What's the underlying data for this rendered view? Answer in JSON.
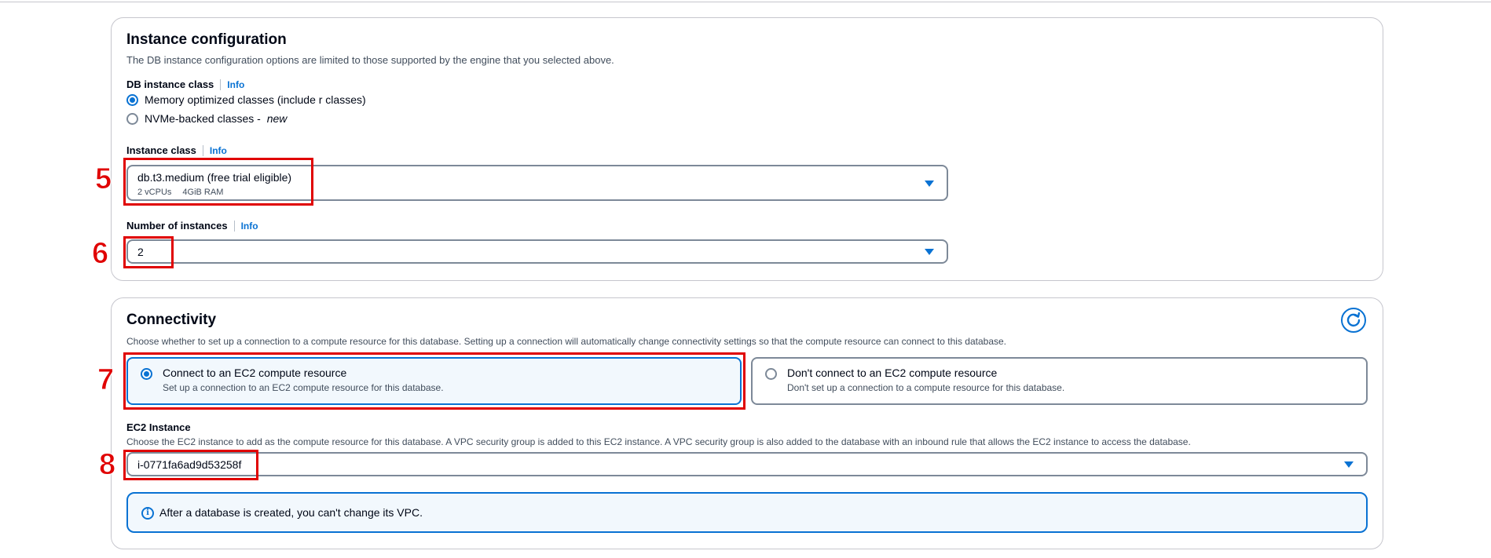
{
  "instance_configuration": {
    "title": "Instance configuration",
    "description": "The DB instance configuration options are limited to those supported by the engine that you selected above.",
    "db_instance_class": {
      "label": "DB instance class",
      "info": "Info",
      "options": [
        {
          "label": "Memory optimized classes (include r classes)",
          "selected": true
        },
        {
          "label": "NVMe-backed classes - ",
          "suffix": "new",
          "selected": false
        }
      ]
    },
    "instance_class": {
      "label": "Instance class",
      "info": "Info",
      "value": "db.t3.medium (free trial eligible)",
      "vcpus": "2 vCPUs",
      "ram": "4GiB RAM"
    },
    "number_of_instances": {
      "label": "Number of instances",
      "info": "Info",
      "value": "2"
    }
  },
  "connectivity": {
    "title": "Connectivity",
    "description": "Choose whether to set up a connection to a compute resource for this database. Setting up a connection will automatically change connectivity settings so that the compute resource can connect to this database.",
    "options": [
      {
        "title": "Connect to an EC2 compute resource",
        "description": "Set up a connection to an EC2 compute resource for this database.",
        "selected": true
      },
      {
        "title": "Don't connect to an EC2 compute resource",
        "description": "Don't set up a connection to a compute resource for this database.",
        "selected": false
      }
    ],
    "ec2_instance": {
      "label": "EC2 Instance",
      "description": "Choose the EC2 instance to add as the compute resource for this database. A VPC security group is added to this EC2 instance. A VPC security group is also added to the database with an inbound rule that allows the EC2 instance to access the database.",
      "value": "i-0771fa6ad9d53258f"
    },
    "alert": "After a database is created, you can't change its VPC."
  },
  "annotations": [
    "5",
    "6",
    "7",
    "8"
  ],
  "colors": {
    "accent": "#0972d3",
    "annotation": "#e00000",
    "border": "#7d8998"
  },
  "icons": {
    "refresh": "refresh-icon",
    "info": "info-circle-icon",
    "caret": "caret-down-icon"
  }
}
